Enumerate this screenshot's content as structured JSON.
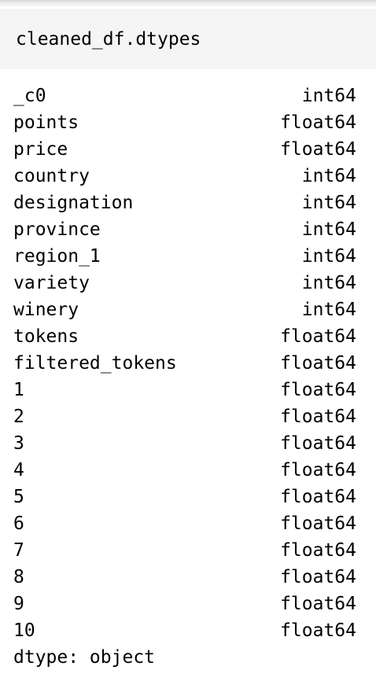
{
  "input": {
    "code": "cleaned_df.dtypes"
  },
  "output": {
    "rows": [
      {
        "name": "_c0",
        "dtype": "int64"
      },
      {
        "name": "points",
        "dtype": "float64"
      },
      {
        "name": "price",
        "dtype": "float64"
      },
      {
        "name": "country",
        "dtype": "int64"
      },
      {
        "name": "designation",
        "dtype": "int64"
      },
      {
        "name": "province",
        "dtype": "int64"
      },
      {
        "name": "region_1",
        "dtype": "int64"
      },
      {
        "name": "variety",
        "dtype": "int64"
      },
      {
        "name": "winery",
        "dtype": "int64"
      },
      {
        "name": "tokens",
        "dtype": "float64"
      },
      {
        "name": "filtered_tokens",
        "dtype": "float64"
      },
      {
        "name": "1",
        "dtype": "float64"
      },
      {
        "name": "2",
        "dtype": "float64"
      },
      {
        "name": "3",
        "dtype": "float64"
      },
      {
        "name": "4",
        "dtype": "float64"
      },
      {
        "name": "5",
        "dtype": "float64"
      },
      {
        "name": "6",
        "dtype": "float64"
      },
      {
        "name": "7",
        "dtype": "float64"
      },
      {
        "name": "8",
        "dtype": "float64"
      },
      {
        "name": "9",
        "dtype": "float64"
      },
      {
        "name": "10",
        "dtype": "float64"
      }
    ],
    "footer": "dtype: object"
  }
}
